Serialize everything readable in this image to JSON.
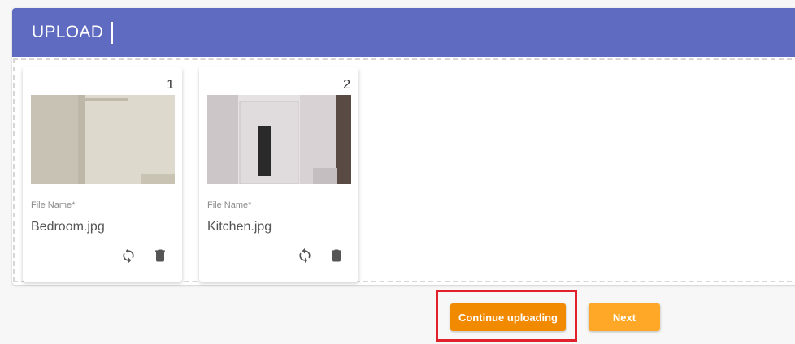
{
  "header": {
    "title": "UPLOAD"
  },
  "files": [
    {
      "index": "1",
      "label": "File Name",
      "required_mark": "*",
      "name": "Bedroom.jpg"
    },
    {
      "index": "2",
      "label": "File Name",
      "required_mark": "*",
      "name": "Kitchen.jpg"
    }
  ],
  "icons": {
    "replace": "refresh-icon",
    "delete": "trash-icon"
  },
  "actions": {
    "continue_label": "Continue uploading",
    "next_label": "Next"
  },
  "colors": {
    "header": "#5e6bc0",
    "continue_button": "#f28a00",
    "next_button": "#ffa726",
    "highlight": "#e0202a"
  }
}
